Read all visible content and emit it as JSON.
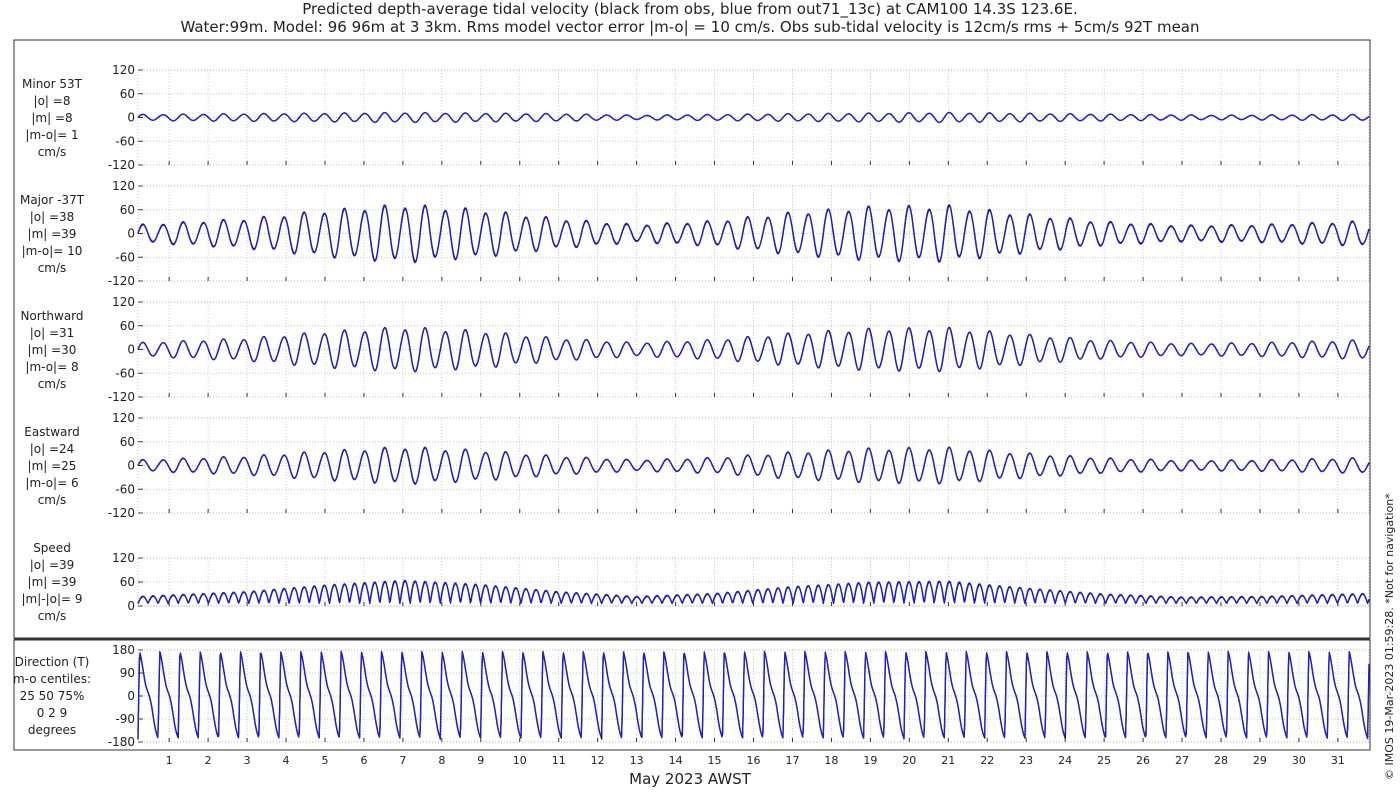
{
  "figure": {
    "title_line1": "Predicted depth-average tidal velocity (black from obs, blue from out71_13c) at CAM100 14.3S 123.6E.",
    "title_line2": "Water:99m. Model: 96 96m at 3 3km. Rms model vector error |m-o| = 10 cm/s. Obs sub-tidal velocity is 12cm/s rms + 5cm/s 92T mean",
    "xlabel": "May 2023 AWST",
    "credit": "© IMOS 19-Mar-2023 01:59:28. *Not for navigation*"
  },
  "panels": [
    {
      "label": [
        "Minor 53T",
        "|o| =8",
        "|m| =8",
        "|m-o|= 1",
        "cm/s"
      ]
    },
    {
      "label": [
        "Major -37T",
        "|o| =38",
        "|m| =39",
        "|m-o|= 10",
        "cm/s"
      ]
    },
    {
      "label": [
        "Northward",
        "|o| =31",
        "|m| =30",
        "|m-o|= 8",
        "cm/s"
      ]
    },
    {
      "label": [
        "Eastward",
        "|o| =24",
        "|m| =25",
        "|m-o|= 6",
        "cm/s"
      ]
    },
    {
      "label": [
        "Speed",
        "|o| =39",
        "|m| =39",
        "|m|-|o|= 9",
        "cm/s"
      ]
    },
    {
      "label": [
        "Direction (T)",
        "m-o centiles:",
        "25  50  75%",
        "0  2  9",
        "degrees"
      ]
    }
  ],
  "colors": {
    "obs": "#000000",
    "model": "#1f1fd0",
    "grid": "#b8b8b8",
    "axis": "#333333"
  },
  "chart_data": [
    {
      "type": "line",
      "panel": "Minor 53T",
      "ylabel": "cm/s",
      "xlim": [
        0.2,
        31.8
      ],
      "ylim": [
        -120,
        120
      ],
      "yticks": [
        -120,
        -60,
        0,
        60,
        120
      ],
      "x_ticks": [
        1,
        2,
        3,
        4,
        5,
        6,
        7,
        8,
        9,
        10,
        11,
        12,
        13,
        14,
        15,
        16,
        17,
        18,
        19,
        20,
        21,
        22,
        23,
        24,
        25,
        26,
        27,
        28,
        29,
        30,
        31
      ],
      "series": [
        {
          "name": "obs",
          "color": "#000000",
          "amplitude_envelope": {
            "x": [
              0.2,
              3,
              7,
              11,
              13,
              17,
              21,
              25,
              28,
              31.8
            ],
            "y": [
              8,
              10,
              13,
              10,
              6,
              10,
              13,
              9,
              6,
              8
            ]
          }
        },
        {
          "name": "model",
          "color": "#1f1fd0",
          "amplitude_envelope": {
            "x": [
              0.2,
              3,
              7,
              11,
              13,
              17,
              21,
              25,
              28,
              31.8
            ],
            "y": [
              8,
              10,
              13,
              10,
              6,
              10,
              13,
              9,
              6,
              8
            ]
          }
        }
      ]
    },
    {
      "type": "line",
      "panel": "Major -37T",
      "ylabel": "cm/s",
      "xlim": [
        0.2,
        31.8
      ],
      "ylim": [
        -120,
        120
      ],
      "yticks": [
        -120,
        -60,
        0,
        60,
        120
      ],
      "series": [
        {
          "name": "obs",
          "color": "#000000",
          "amplitude_envelope": {
            "x": [
              0.2,
              3,
              5,
              7,
              9,
              11,
              13,
              15,
              17,
              19,
              21,
              23,
              25,
              27,
              29,
              31.8
            ],
            "y": [
              22,
              38,
              60,
              75,
              62,
              38,
              22,
              32,
              55,
              70,
              72,
              50,
              30,
              20,
              22,
              32
            ]
          }
        },
        {
          "name": "model",
          "color": "#1f1fd0",
          "amplitude_envelope": {
            "x": [
              0.2,
              3,
              5,
              7,
              9,
              11,
              13,
              15,
              17,
              19,
              21,
              23,
              25,
              27,
              29,
              31.8
            ],
            "y": [
              24,
              40,
              62,
              78,
              64,
              40,
              24,
              34,
              57,
              72,
              75,
              52,
              32,
              22,
              24,
              34
            ]
          }
        }
      ]
    },
    {
      "type": "line",
      "panel": "Northward",
      "ylabel": "cm/s",
      "xlim": [
        0.2,
        31.8
      ],
      "ylim": [
        -120,
        120
      ],
      "yticks": [
        -120,
        -60,
        0,
        60,
        120
      ],
      "series": [
        {
          "name": "obs",
          "color": "#000000",
          "amplitude_envelope": {
            "x": [
              0.2,
              3,
              5,
              7,
              9,
              11,
              13,
              15,
              17,
              19,
              21,
              23,
              25,
              27,
              29,
              31.8
            ],
            "y": [
              18,
              30,
              48,
              60,
              50,
              30,
              18,
              26,
              44,
              56,
              58,
              40,
              24,
              16,
              18,
              26
            ]
          }
        },
        {
          "name": "model",
          "color": "#1f1fd0",
          "amplitude_envelope": {
            "x": [
              0.2,
              3,
              5,
              7,
              9,
              11,
              13,
              15,
              17,
              19,
              21,
              23,
              25,
              27,
              29,
              31.8
            ],
            "y": [
              18,
              30,
              47,
              59,
              49,
              30,
              18,
              26,
              43,
              55,
              57,
              40,
              24,
              16,
              18,
              26
            ]
          }
        }
      ]
    },
    {
      "type": "line",
      "panel": "Eastward",
      "ylabel": "cm/s",
      "xlim": [
        0.2,
        31.8
      ],
      "ylim": [
        -120,
        120
      ],
      "yticks": [
        -120,
        -60,
        0,
        60,
        120
      ],
      "series": [
        {
          "name": "obs",
          "color": "#000000",
          "amplitude_envelope": {
            "x": [
              0.2,
              3,
              5,
              7,
              9,
              11,
              13,
              15,
              17,
              19,
              21,
              23,
              25,
              27,
              29,
              31.8
            ],
            "y": [
              14,
              24,
              38,
              48,
              40,
              24,
              14,
              20,
              35,
              45,
              47,
              32,
              19,
              13,
              14,
              20
            ]
          }
        },
        {
          "name": "model",
          "color": "#1f1fd0",
          "amplitude_envelope": {
            "x": [
              0.2,
              3,
              5,
              7,
              9,
              11,
              13,
              15,
              17,
              19,
              21,
              23,
              25,
              27,
              29,
              31.8
            ],
            "y": [
              15,
              25,
              39,
              50,
              41,
              25,
              15,
              21,
              36,
              46,
              48,
              33,
              20,
              14,
              15,
              21
            ]
          }
        }
      ]
    },
    {
      "type": "line",
      "panel": "Speed",
      "ylabel": "cm/s",
      "xlim": [
        0.2,
        31.8
      ],
      "ylim": [
        0,
        120
      ],
      "yticks": [
        0,
        60,
        120
      ],
      "series": [
        {
          "name": "obs",
          "color": "#000000",
          "amplitude_envelope": {
            "x": [
              0.2,
              3,
              5,
              7,
              9,
              11,
              13,
              15,
              17,
              19,
              21,
              23,
              25,
              27,
              29,
              31.8
            ],
            "y": [
              22,
              38,
              60,
              75,
              62,
              38,
              22,
              32,
              55,
              70,
              72,
              50,
              30,
              20,
              22,
              32
            ]
          }
        },
        {
          "name": "model",
          "color": "#1f1fd0",
          "amplitude_envelope": {
            "x": [
              0.2,
              3,
              5,
              7,
              9,
              11,
              13,
              15,
              17,
              19,
              21,
              23,
              25,
              27,
              29,
              31.8
            ],
            "y": [
              24,
              40,
              62,
              78,
              64,
              40,
              24,
              34,
              57,
              72,
              75,
              52,
              32,
              22,
              24,
              34
            ]
          }
        }
      ]
    },
    {
      "type": "line",
      "panel": "Direction (T)",
      "ylabel": "degrees",
      "xlim": [
        0.2,
        31.8
      ],
      "ylim": [
        -180,
        180
      ],
      "yticks": [
        -180,
        -90,
        0,
        90,
        180
      ],
      "series": [
        {
          "name": "obs",
          "color": "#000000"
        },
        {
          "name": "model",
          "color": "#1f1fd0"
        }
      ]
    }
  ]
}
